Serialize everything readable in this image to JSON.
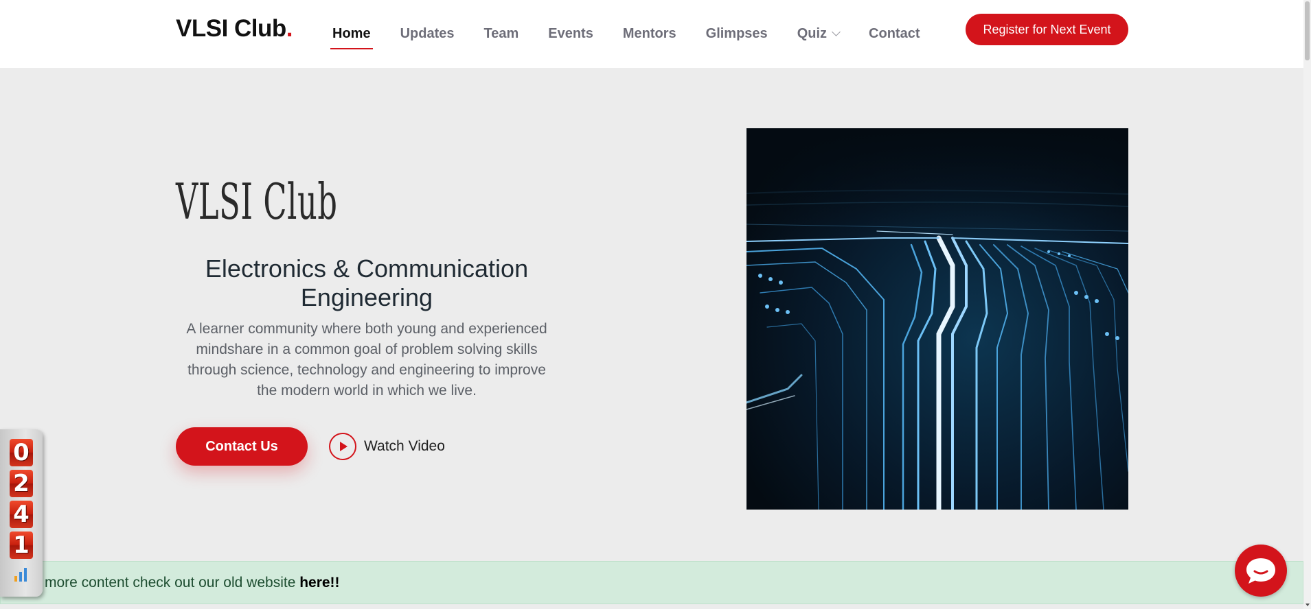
{
  "header": {
    "logo_text": "VLSI Club",
    "logo_dot": ".",
    "nav": [
      {
        "label": "Home",
        "active": true
      },
      {
        "label": "Updates"
      },
      {
        "label": "Team"
      },
      {
        "label": "Events"
      },
      {
        "label": "Mentors"
      },
      {
        "label": "Glimpses"
      },
      {
        "label": "Quiz",
        "has_dropdown": true
      },
      {
        "label": "Contact"
      }
    ],
    "register_label": "Register for Next Event"
  },
  "hero": {
    "title": "VLSI Club",
    "subtitle": "Electronics & Communication Engineering",
    "description": "A learner community where both young and experienced mindshare in a common goal of problem solving skills through science, technology and engineering to improve the modern world in which we live.",
    "contact_label": "Contact Us",
    "watch_label": "Watch Video"
  },
  "banner": {
    "text": "more content check out our old website ",
    "link_text": "here!!"
  },
  "counter": {
    "digits": [
      "0",
      "2",
      "4",
      "1"
    ]
  },
  "colors": {
    "accent": "#d3141b",
    "hero_bg": "#ececec",
    "banner_bg": "#d3ebdc"
  },
  "icons": {
    "play": "play-icon",
    "chat": "chat-icon",
    "dropdown": "chevron-down-icon",
    "stats": "bar-chart-icon"
  }
}
